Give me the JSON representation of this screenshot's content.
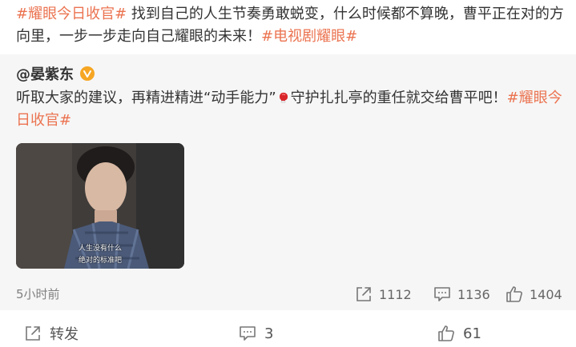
{
  "post": {
    "text": {
      "topic1": "#耀眼今日收官#",
      "body": " 找到自己的人生节奏勇敢蜕变，什么时候都不算晚，曹平正在对的方向里，一步一步走向自己耀眼的未来！",
      "topic2": "#电视剧耀眼#"
    }
  },
  "quoted": {
    "author": "@晏紫东",
    "badge_icon": "verified-badge-icon",
    "text_part1": "听取大家的建议，再精进精进“动手能力”",
    "emoji_icon": "boxing-glove-icon",
    "text_part2": "守护扎扎亭的重任就交给曹平吧！",
    "topic": "#耀眼今日收官#",
    "media": {
      "subtitle_line1": "人生没有什么",
      "subtitle_line2": "绝对的标准吧"
    },
    "meta": {
      "time": "5小时前",
      "reposts": "1112",
      "comments": "1136",
      "likes": "1404"
    }
  },
  "actions": {
    "repost_label": "转发",
    "comment_count": "3",
    "like_count": "61"
  },
  "colors": {
    "topic": "#eb7350",
    "badge": "#f6a623",
    "quoted_bg": "#f6f6f6"
  }
}
